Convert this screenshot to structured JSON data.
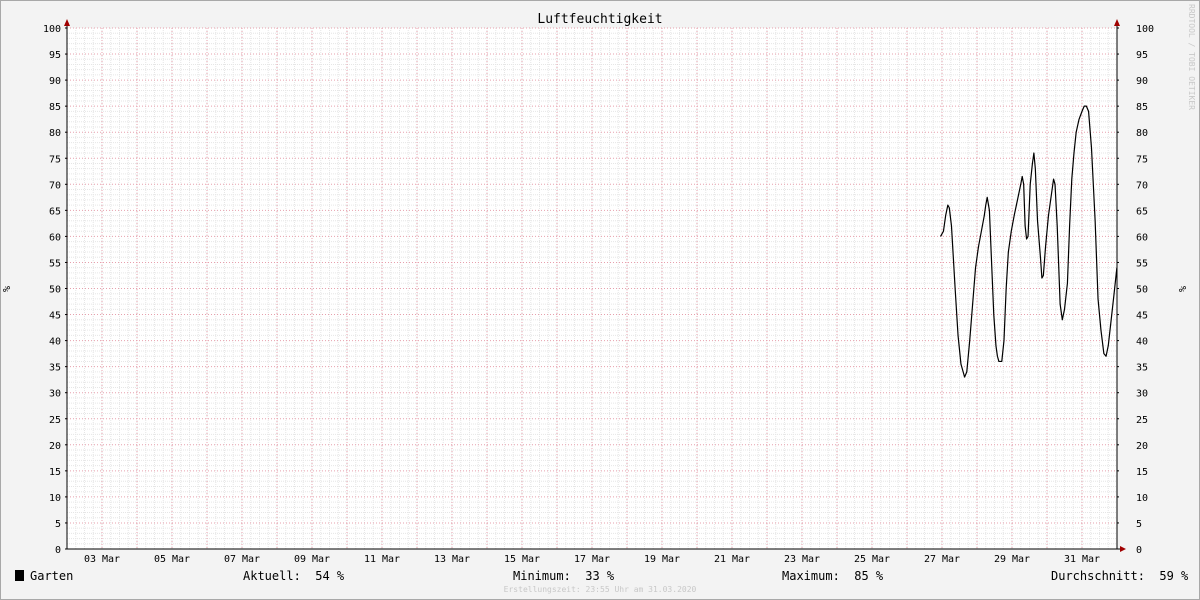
{
  "chart_data": {
    "type": "line",
    "title": "Luftfeuchtigkeit",
    "ylabel": "%",
    "ylim": [
      0,
      100
    ],
    "xlim": [
      "2020-03-02",
      "2020-04-01"
    ],
    "grid": true,
    "yticks": [
      0,
      5,
      10,
      15,
      20,
      25,
      30,
      35,
      40,
      45,
      50,
      55,
      60,
      65,
      70,
      75,
      80,
      85,
      90,
      95,
      100
    ],
    "xticks": [
      {
        "date": "2020-03-03",
        "label": "03 Mar"
      },
      {
        "date": "2020-03-05",
        "label": "05 Mar"
      },
      {
        "date": "2020-03-07",
        "label": "07 Mar"
      },
      {
        "date": "2020-03-09",
        "label": "09 Mar"
      },
      {
        "date": "2020-03-11",
        "label": "11 Mar"
      },
      {
        "date": "2020-03-13",
        "label": "13 Mar"
      },
      {
        "date": "2020-03-15",
        "label": "15 Mar"
      },
      {
        "date": "2020-03-17",
        "label": "17 Mar"
      },
      {
        "date": "2020-03-19",
        "label": "19 Mar"
      },
      {
        "date": "2020-03-21",
        "label": "21 Mar"
      },
      {
        "date": "2020-03-23",
        "label": "23 Mar"
      },
      {
        "date": "2020-03-25",
        "label": "25 Mar"
      },
      {
        "date": "2020-03-27",
        "label": "27 Mar"
      },
      {
        "date": "2020-03-29",
        "label": "29 Mar"
      },
      {
        "date": "2020-03-31",
        "label": "31 Mar"
      }
    ],
    "series": [
      {
        "name": "Garten",
        "color": "#000000",
        "points": [
          [
            "2020-03-26 23:00",
            60
          ],
          [
            "2020-03-27 01:00",
            61
          ],
          [
            "2020-03-27 02:30",
            64
          ],
          [
            "2020-03-27 04:00",
            66
          ],
          [
            "2020-03-27 05:00",
            65.5
          ],
          [
            "2020-03-27 06:30",
            62
          ],
          [
            "2020-03-27 09:00",
            50
          ],
          [
            "2020-03-27 11:00",
            41
          ],
          [
            "2020-03-27 13:00",
            35.5
          ],
          [
            "2020-03-27 14:30",
            34
          ],
          [
            "2020-03-27 15:30",
            33
          ],
          [
            "2020-03-27 17:00",
            34
          ],
          [
            "2020-03-27 19:00",
            40
          ],
          [
            "2020-03-27 21:00",
            47
          ],
          [
            "2020-03-27 23:00",
            54
          ],
          [
            "2020-03-28 01:00",
            58
          ],
          [
            "2020-03-28 03:00",
            61
          ],
          [
            "2020-03-28 05:00",
            64
          ],
          [
            "2020-03-28 06:00",
            66
          ],
          [
            "2020-03-28 07:00",
            67.5
          ],
          [
            "2020-03-28 08:30",
            65
          ],
          [
            "2020-03-28 10:00",
            55
          ],
          [
            "2020-03-28 11:30",
            45
          ],
          [
            "2020-03-28 13:00",
            39
          ],
          [
            "2020-03-28 14:00",
            37
          ],
          [
            "2020-03-28 15:00",
            36
          ],
          [
            "2020-03-28 17:00",
            36
          ],
          [
            "2020-03-28 18:30",
            40
          ],
          [
            "2020-03-28 20:00",
            50
          ],
          [
            "2020-03-28 21:30",
            57
          ],
          [
            "2020-03-28 23:30",
            61
          ],
          [
            "2020-03-29 01:30",
            64
          ],
          [
            "2020-03-29 03:00",
            66
          ],
          [
            "2020-03-29 04:30",
            68
          ],
          [
            "2020-03-29 06:00",
            70
          ],
          [
            "2020-03-29 07:00",
            71.5
          ],
          [
            "2020-03-29 08:00",
            70
          ],
          [
            "2020-03-29 09:00",
            62
          ],
          [
            "2020-03-29 10:00",
            59.5
          ],
          [
            "2020-03-29 11:00",
            60
          ],
          [
            "2020-03-29 12:30",
            70
          ],
          [
            "2020-03-29 14:00",
            74
          ],
          [
            "2020-03-29 15:00",
            76
          ],
          [
            "2020-03-29 16:00",
            73
          ],
          [
            "2020-03-29 17:30",
            63
          ],
          [
            "2020-03-29 19:30",
            56
          ],
          [
            "2020-03-29 20:30",
            52
          ],
          [
            "2020-03-29 21:30",
            52.5
          ],
          [
            "2020-03-29 23:00",
            58
          ],
          [
            "2020-03-30 01:00",
            64
          ],
          [
            "2020-03-30 03:00",
            68
          ],
          [
            "2020-03-30 04:30",
            71
          ],
          [
            "2020-03-30 05:30",
            70
          ],
          [
            "2020-03-30 07:00",
            62
          ],
          [
            "2020-03-30 09:00",
            47
          ],
          [
            "2020-03-30 10:30",
            44
          ],
          [
            "2020-03-30 12:00",
            46
          ],
          [
            "2020-03-30 14:00",
            51
          ],
          [
            "2020-03-30 15:30",
            62
          ],
          [
            "2020-03-30 17:00",
            71
          ],
          [
            "2020-03-30 18:30",
            76
          ],
          [
            "2020-03-30 20:00",
            80
          ],
          [
            "2020-03-30 22:00",
            82.5
          ],
          [
            "2020-03-31 00:00",
            84
          ],
          [
            "2020-03-31 01:30",
            85
          ],
          [
            "2020-03-31 03:00",
            85
          ],
          [
            "2020-03-31 04:30",
            84
          ],
          [
            "2020-03-31 06:30",
            77
          ],
          [
            "2020-03-31 09:00",
            63
          ],
          [
            "2020-03-31 11:00",
            48
          ],
          [
            "2020-03-31 13:00",
            42
          ],
          [
            "2020-03-31 15:00",
            37.5
          ],
          [
            "2020-03-31 16:30",
            37
          ],
          [
            "2020-03-31 18:00",
            39
          ],
          [
            "2020-03-31 20:00",
            44
          ],
          [
            "2020-03-31 22:00",
            49
          ],
          [
            "2020-03-31 23:55",
            54
          ]
        ]
      }
    ]
  },
  "legend": {
    "series_name": "Garten",
    "current_label": "Aktuell:",
    "current_value": "54 %",
    "min_label": "Minimum:",
    "min_value": "33 %",
    "max_label": "Maximum:",
    "max_value": "85 %",
    "avg_label": "Durchschnitt:",
    "avg_value": "59 %"
  },
  "footer_text": "Erstellungszeit: 23:55 Uhr am 31.03.2020",
  "watermark": "RRDTOOL / TOBI OETIKER",
  "colors": {
    "canvas": "#ffffff",
    "minor_grid": "#e6e6e6",
    "major_grid": "#e7a0ad",
    "axis": "#000000",
    "arrow": "#a00000",
    "line": "#000000"
  }
}
